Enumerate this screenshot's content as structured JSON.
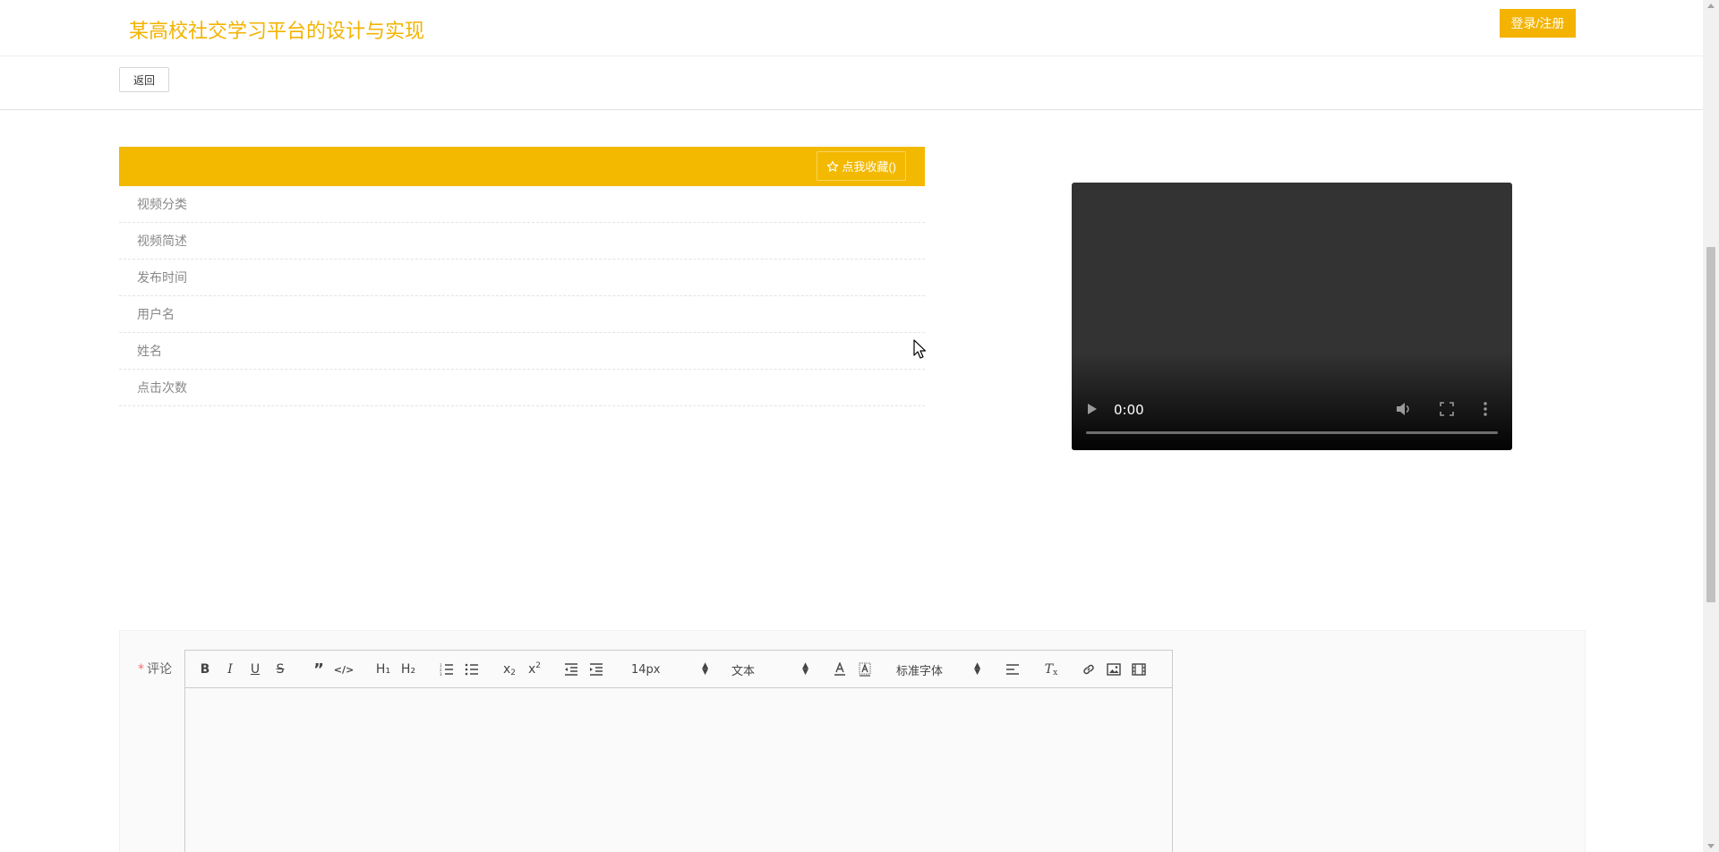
{
  "header": {
    "site_title": "某高校社交学习平台的设计与实现",
    "login_label": "登录/注册"
  },
  "backbar": {
    "back_label": "返回"
  },
  "detail": {
    "favorite_label": "点我收藏()",
    "rows": [
      {
        "label": "视频分类"
      },
      {
        "label": "视频简述"
      },
      {
        "label": "发布时间"
      },
      {
        "label": "用户名"
      },
      {
        "label": "姓名"
      },
      {
        "label": "点击次数"
      }
    ]
  },
  "video": {
    "time": "0:00",
    "progress": 0
  },
  "comment": {
    "required_mark": "*",
    "label": "评论",
    "toolbar": {
      "font_size": "14px",
      "block_type": "文本",
      "font_family": "标准字体"
    }
  },
  "colors": {
    "accent": "#f3b300",
    "header_bar": "#f3b900",
    "required": "#f56c6c"
  }
}
